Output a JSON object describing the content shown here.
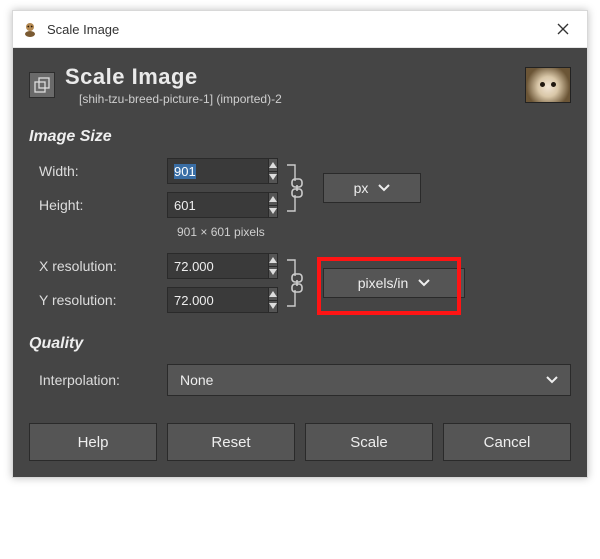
{
  "window": {
    "title": "Scale Image"
  },
  "header": {
    "title": "Scale Image",
    "subtitle": "[shih-tzu-breed-picture-1] (imported)-2"
  },
  "sections": {
    "image_size": "Image Size",
    "quality": "Quality"
  },
  "labels": {
    "width": "Width:",
    "height": "Height:",
    "xres": "X resolution:",
    "yres": "Y resolution:",
    "interp": "Interpolation:"
  },
  "values": {
    "width": "901",
    "height": "601",
    "xres": "72.000",
    "yres": "72.000",
    "size_note": "901 × 601 pixels"
  },
  "units": {
    "size": "px",
    "res": "pixels/in"
  },
  "interpolation": {
    "value": "None"
  },
  "buttons": {
    "help": "Help",
    "reset": "Reset",
    "scale": "Scale",
    "cancel": "Cancel"
  }
}
